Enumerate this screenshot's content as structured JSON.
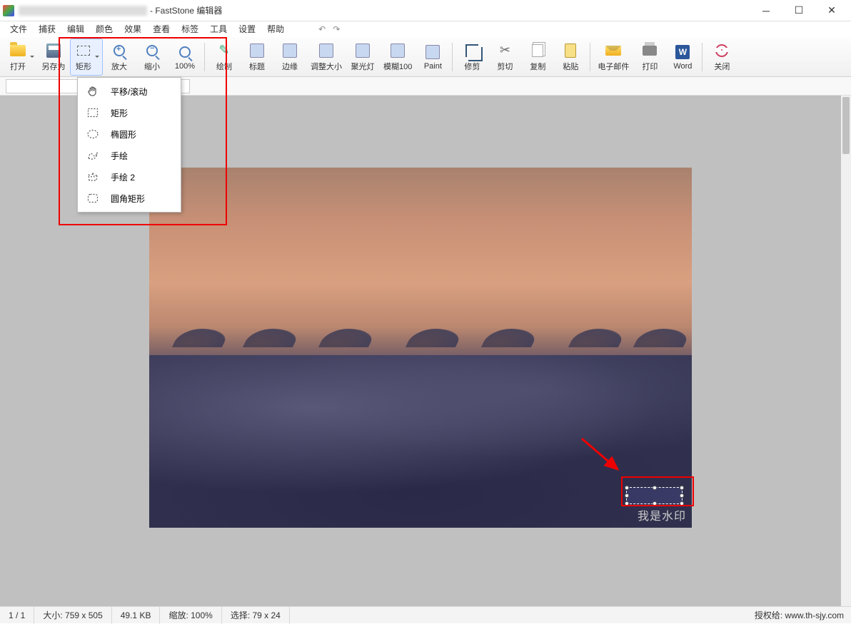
{
  "title": {
    "suffix": "- FastStone 编辑器"
  },
  "menu": {
    "items": [
      "文件",
      "捕获",
      "编辑",
      "颜色",
      "效果",
      "查看",
      "标签",
      "工具",
      "设置",
      "帮助"
    ]
  },
  "toolbar": {
    "open": "打开",
    "saveas": "另存为",
    "rect": "矩形",
    "zoomin": "放大",
    "zoomout": "缩小",
    "zoom100": "100%",
    "draw": "绘制",
    "caption": "标题",
    "edge": "边缘",
    "resize": "调整大小",
    "spotlight": "聚光灯",
    "blur": "模糊100",
    "paint": "Paint",
    "crop": "修剪",
    "cut": "剪切",
    "copy": "复制",
    "paste": "粘贴",
    "email": "电子邮件",
    "print": "打印",
    "word": "Word",
    "close": "关闭"
  },
  "dropdown": {
    "pan": "平移/滚动",
    "rect": "矩形",
    "ellipse": "椭圆形",
    "freehand": "手绘",
    "freehand2": "手绘 2",
    "roundrect": "圆角矩形"
  },
  "watermark": "我是水印",
  "status": {
    "page": "1 / 1",
    "size": "大小: 759 x 505",
    "filesize": "49.1 KB",
    "zoom": "缩放: 100%",
    "selection": "选择: 79 x 24",
    "credit": "授权给: www.th-sjy.com"
  }
}
